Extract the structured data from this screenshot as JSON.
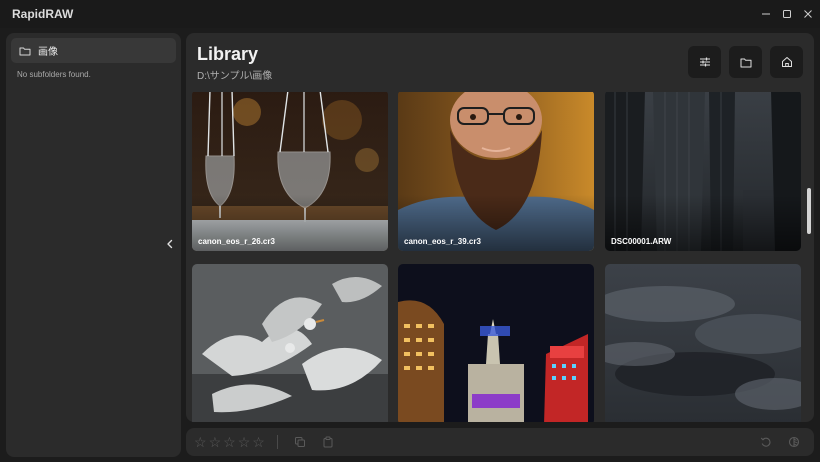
{
  "window": {
    "title": "RapidRAW"
  },
  "sidebar": {
    "folder": {
      "name": "画像",
      "icon": "folder-icon"
    },
    "empty_message": "No subfolders found."
  },
  "library": {
    "title": "Library",
    "path": "D:\\サンプル\\画像",
    "header_buttons": [
      {
        "icon": "sliders-icon"
      },
      {
        "icon": "folder-icon"
      },
      {
        "icon": "home-icon"
      }
    ]
  },
  "thumbnails": [
    {
      "name": "canon_eos_r_26.cr3"
    },
    {
      "name": "canon_eos_r_39.cr3"
    },
    {
      "name": "DSC00001.ARW"
    },
    {
      "name": ""
    },
    {
      "name": ""
    },
    {
      "name": ""
    }
  ],
  "bottom_bar": {
    "rating_max": 5,
    "rating": 0
  },
  "colors": {
    "background": "#1c1c1c",
    "panel": "#2b2b2b",
    "accent_folder": "#383838",
    "button": "#1c1c1c"
  }
}
